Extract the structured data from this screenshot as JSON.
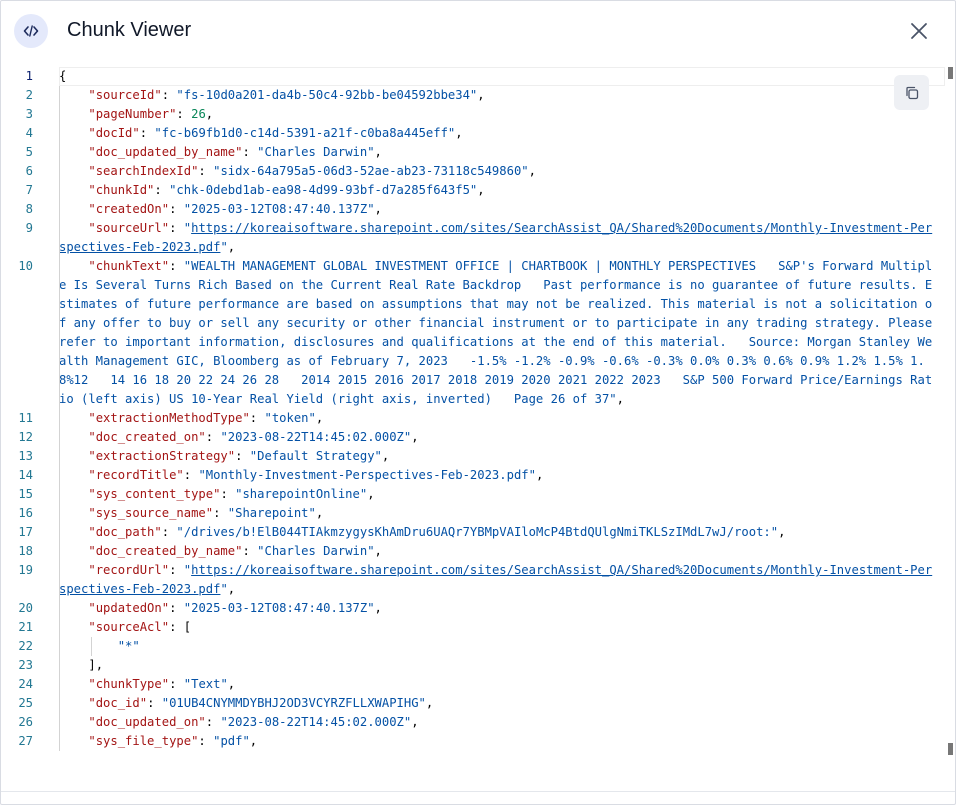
{
  "header": {
    "title": "Chunk Viewer",
    "icon": "code-icon",
    "close_icon": "close-icon"
  },
  "toolbar": {
    "copy_icon": "copy-icon"
  },
  "editor": {
    "lines": [
      {
        "num": "1",
        "html": "{"
      },
      {
        "num": "2",
        "key": "sourceId",
        "val": "\"fs-10d0a201-da4b-50c4-92bb-be04592bbe34\"",
        "type": "s"
      },
      {
        "num": "3",
        "key": "pageNumber",
        "val": "26",
        "type": "n"
      },
      {
        "num": "4",
        "key": "docId",
        "val": "\"fc-b69fb1d0-c14d-5391-a21f-c0ba8a445eff\"",
        "type": "s"
      },
      {
        "num": "5",
        "key": "doc_updated_by_name",
        "val": "\"Charles Darwin\"",
        "type": "s"
      },
      {
        "num": "6",
        "key": "searchIndexId",
        "val": "\"sidx-64a795a5-06d3-52ae-ab23-73118c549860\"",
        "type": "s"
      },
      {
        "num": "7",
        "key": "chunkId",
        "val": "\"chk-0debd1ab-ea98-4d99-93bf-d7a285f643f5\"",
        "type": "s"
      },
      {
        "num": "8",
        "key": "createdOn",
        "val": "\"2025-03-12T08:47:40.137Z\"",
        "type": "s"
      },
      {
        "num": "9",
        "key": "sourceUrl",
        "val": "\"https://koreaisoftware.sharepoint.com/sites/SearchAssist_QA/Shared%20Documents/Monthly-Investment-Perspectives-Feb-2023.pdf\"",
        "type": "url",
        "url": "https://koreaisoftware.sharepoint.com/sites/SearchAssist_QA/Shared%20Documents/Monthly-Investment-Perspectives-Feb-2023.pdf"
      },
      {
        "num": "10",
        "key": "chunkText",
        "val": "\"WEALTH MANAGEMENT GLOBAL INVESTMENT OFFICE | CHARTBOOK | MONTHLY PERSPECTIVES   S&P's Forward Multiple Is Several Turns Rich Based on the Current Real Rate Backdrop   Past performance is no guarantee of future results. Estimates of future performance are based on assumptions that may not be realized. This material is not a solicitation of any offer to buy or sell any security or other financial instrument or to participate in any trading strategy. Please refer to important information, disclosures and qualifications at the end of this material.   Source: Morgan Stanley Wealth Management GIC, Bloomberg as of February 7, 2023   -1.5% -1.2% -0.9% -0.6% -0.3% 0.0% 0.3% 0.6% 0.9% 1.2% 1.5% 1.8%12   14 16 18 20 22 24 26 28   2014 2015 2016 2017 2018 2019 2020 2021 2022 2023   S&P 500 Forward Price/Earnings Ratio (left axis) US 10-Year Real Yield (right axis, inverted)   Page 26 of 37\"",
        "type": "s"
      },
      {
        "num": "11",
        "key": "extractionMethodType",
        "val": "\"token\"",
        "type": "s"
      },
      {
        "num": "12",
        "key": "doc_created_on",
        "val": "\"2023-08-22T14:45:02.000Z\"",
        "type": "s"
      },
      {
        "num": "13",
        "key": "extractionStrategy",
        "val": "\"Default Strategy\"",
        "type": "s"
      },
      {
        "num": "14",
        "key": "recordTitle",
        "val": "\"Monthly-Investment-Perspectives-Feb-2023.pdf\"",
        "type": "s"
      },
      {
        "num": "15",
        "key": "sys_content_type",
        "val": "\"sharepointOnline\"",
        "type": "s"
      },
      {
        "num": "16",
        "key": "sys_source_name",
        "val": "\"Sharepoint\"",
        "type": "s"
      },
      {
        "num": "17",
        "key": "doc_path",
        "val": "\"/drives/b!ElB044TIAkmzygysKhAmDru6UAQr7YBMpVAIloMcP4BtdQUlgNmiTKLSzIMdL7wJ/root:\"",
        "type": "s"
      },
      {
        "num": "18",
        "key": "doc_created_by_name",
        "val": "\"Charles Darwin\"",
        "type": "s"
      },
      {
        "num": "19",
        "key": "recordUrl",
        "val": "\"https://koreaisoftware.sharepoint.com/sites/SearchAssist_QA/Shared%20Documents/Monthly-Investment-Perspectives-Feb-2023.pdf\"",
        "type": "url",
        "url": "https://koreaisoftware.sharepoint.com/sites/SearchAssist_QA/Shared%20Documents/Monthly-Investment-Perspectives-Feb-2023.pdf"
      },
      {
        "num": "20",
        "key": "updatedOn",
        "val": "\"2025-03-12T08:47:40.137Z\"",
        "type": "s"
      },
      {
        "num": "21",
        "key": "sourceAcl",
        "val": "[",
        "type": "p",
        "nocomma": true
      },
      {
        "num": "22",
        "raw": "\"*\"",
        "type": "s",
        "depth": 2
      },
      {
        "num": "23",
        "raw": "],",
        "type": "p",
        "depth": 1
      },
      {
        "num": "24",
        "key": "chunkType",
        "val": "\"Text\"",
        "type": "s"
      },
      {
        "num": "25",
        "key": "doc_id",
        "val": "\"01UB4CNYMMDYBHJ2OD3VCYRZFLLXWAPIHG\"",
        "type": "s"
      },
      {
        "num": "26",
        "key": "doc_updated_on",
        "val": "\"2023-08-22T14:45:02.000Z\"",
        "type": "s"
      },
      {
        "num": "27",
        "key": "sys_file_type",
        "val": "\"pdf\"",
        "type": "s"
      }
    ]
  }
}
